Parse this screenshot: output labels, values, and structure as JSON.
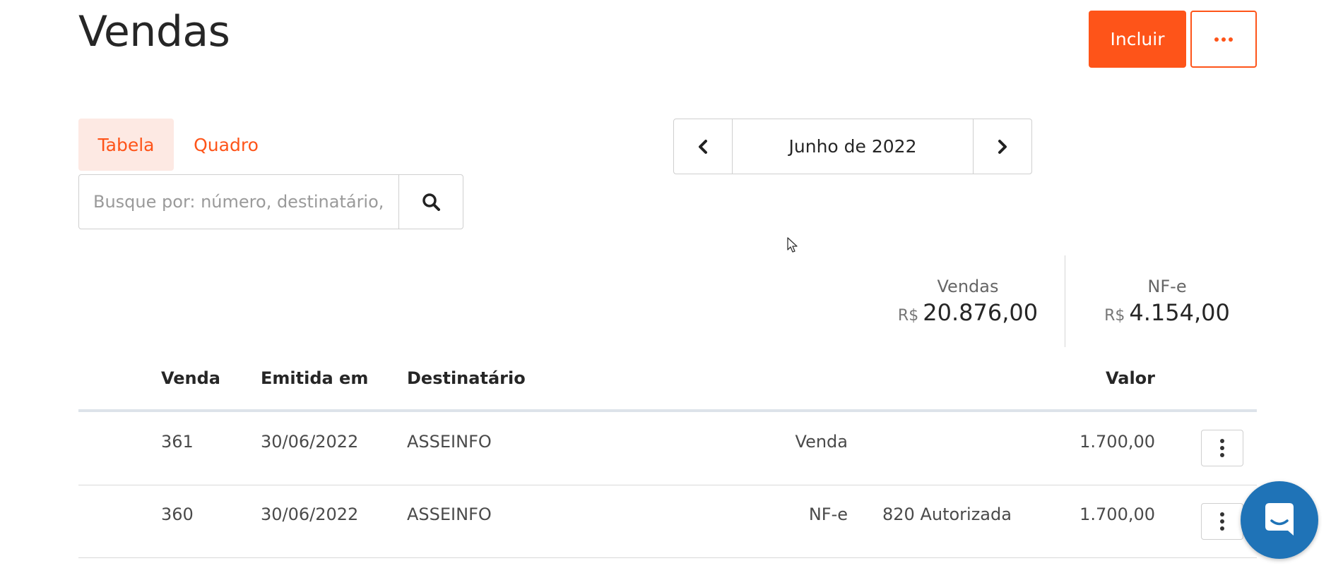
{
  "page": {
    "title": "Vendas"
  },
  "actions": {
    "include_label": "Incluir",
    "more_icon": "ellipsis-icon"
  },
  "view_tabs": [
    {
      "label": "Tabela",
      "active": true
    },
    {
      "label": "Quadro",
      "active": false
    }
  ],
  "search": {
    "placeholder": "Busque por: número, destinatário, natureza",
    "value": "",
    "icon": "search-icon"
  },
  "period": {
    "label": "Junho de 2022",
    "prev_icon": "chevron-left-icon",
    "next_icon": "chevron-right-icon"
  },
  "summary": [
    {
      "caption": "Vendas",
      "currency": "R$",
      "amount": "20.876,00"
    },
    {
      "caption": "NF-e",
      "currency": "R$",
      "amount": "4.154,00"
    }
  ],
  "table": {
    "columns": [
      "Venda",
      "Emitida em",
      "Destinatário",
      "Valor"
    ],
    "rows": [
      {
        "number": "361",
        "date": "30/06/2022",
        "recipient": "ASSEINFO",
        "type": "Venda",
        "status": "",
        "value": "1.700,00"
      },
      {
        "number": "360",
        "date": "30/06/2022",
        "recipient": "ASSEINFO",
        "type": "NF-e",
        "status": "820 Autorizada",
        "value": "1.700,00"
      }
    ]
  },
  "colors": {
    "accent": "#fe5419",
    "accent_soft": "#fde9e3",
    "chat": "#1f73b7"
  },
  "chat": {
    "icon": "chat-widget-icon"
  }
}
